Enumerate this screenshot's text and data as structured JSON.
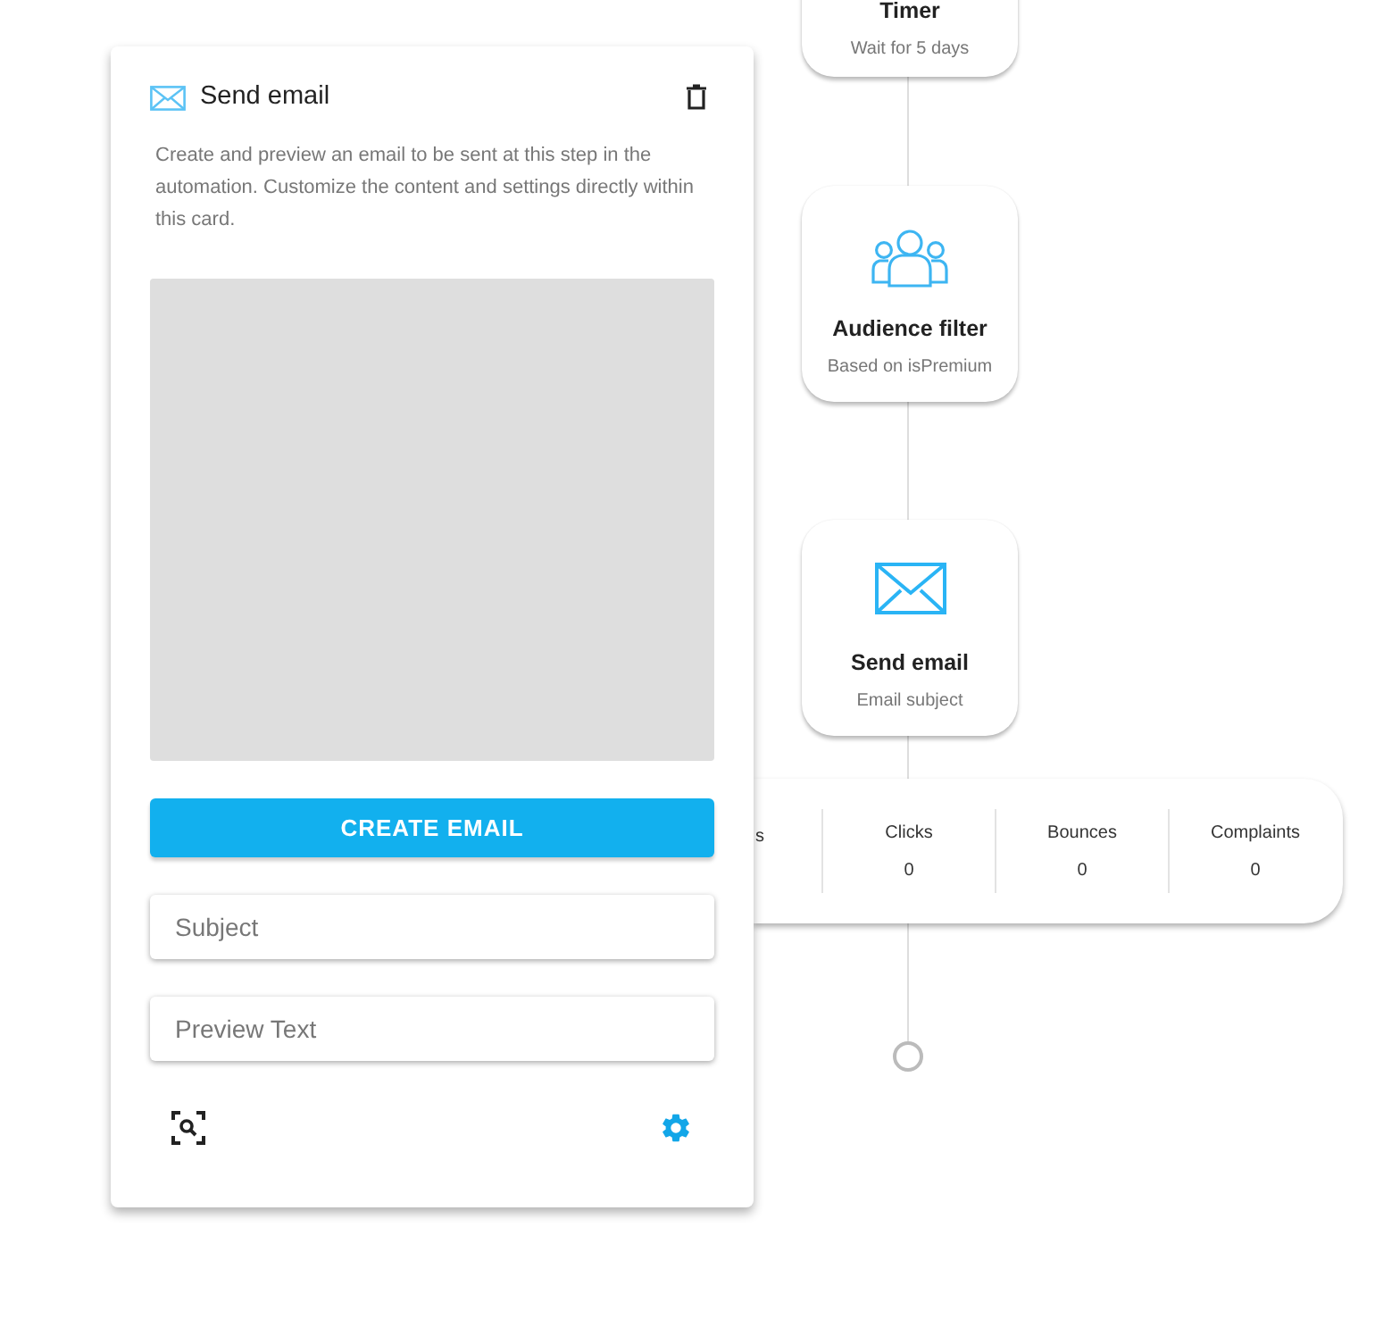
{
  "nodes": [
    {
      "kind": "timer",
      "title": "Timer",
      "subtitle": "Wait for 5 days"
    },
    {
      "kind": "audience",
      "title": "Audience filter",
      "subtitle": "Based on isPremium"
    },
    {
      "kind": "email",
      "title": "Send email",
      "subtitle": "Email subject"
    }
  ],
  "stats": [
    {
      "label": "s"
    },
    {
      "label": "Clicks",
      "value": "0"
    },
    {
      "label": "Bounces",
      "value": "0"
    },
    {
      "label": "Complaints",
      "value": "0"
    }
  ],
  "panel": {
    "title": "Send email",
    "description": "Create and preview an email to be sent at this step in the automation. Customize the content and settings directly within this card.",
    "button": "CREATE EMAIL",
    "fields": [
      {
        "placeholder": "Subject"
      },
      {
        "placeholder": "Preview Text"
      }
    ]
  }
}
